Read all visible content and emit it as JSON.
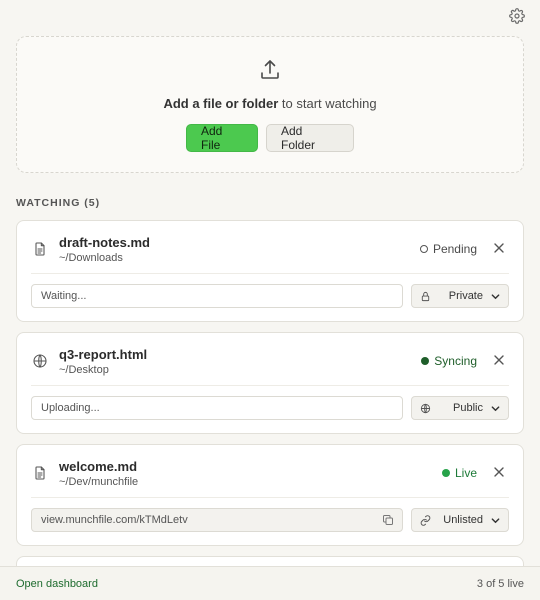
{
  "dropzone": {
    "headline_bold": "Add a file or folder",
    "headline_rest": " to start watching",
    "add_file_label": "Add File",
    "add_folder_label": "Add Folder"
  },
  "watching": {
    "title": "WATCHING (5)",
    "items": [
      {
        "name": "draft-notes.md",
        "path": "~/Downloads",
        "file_icon": "document-icon",
        "status": "Pending",
        "field_text": "Waiting...",
        "visibility": "Private",
        "visibility_icon": "lock-icon"
      },
      {
        "name": "q3-report.html",
        "path": "~/Desktop",
        "file_icon": "globe-icon",
        "status": "Syncing",
        "field_text": "Uploading...",
        "visibility": "Public",
        "visibility_icon": "globe-icon"
      },
      {
        "name": "welcome.md",
        "path": "~/Dev/munchfile",
        "file_icon": "document-icon",
        "status": "Live",
        "field_text": "view.munchfile.com/kTMdLetv",
        "visibility": "Unlisted",
        "visibility_icon": "link-icon"
      }
    ]
  },
  "footer": {
    "dashboard_link": "Open dashboard",
    "live_count": "3 of 5 live"
  },
  "colors": {
    "accent": "#4cc94f",
    "syncing": "#1f5e2a",
    "live": "#27a34a"
  }
}
